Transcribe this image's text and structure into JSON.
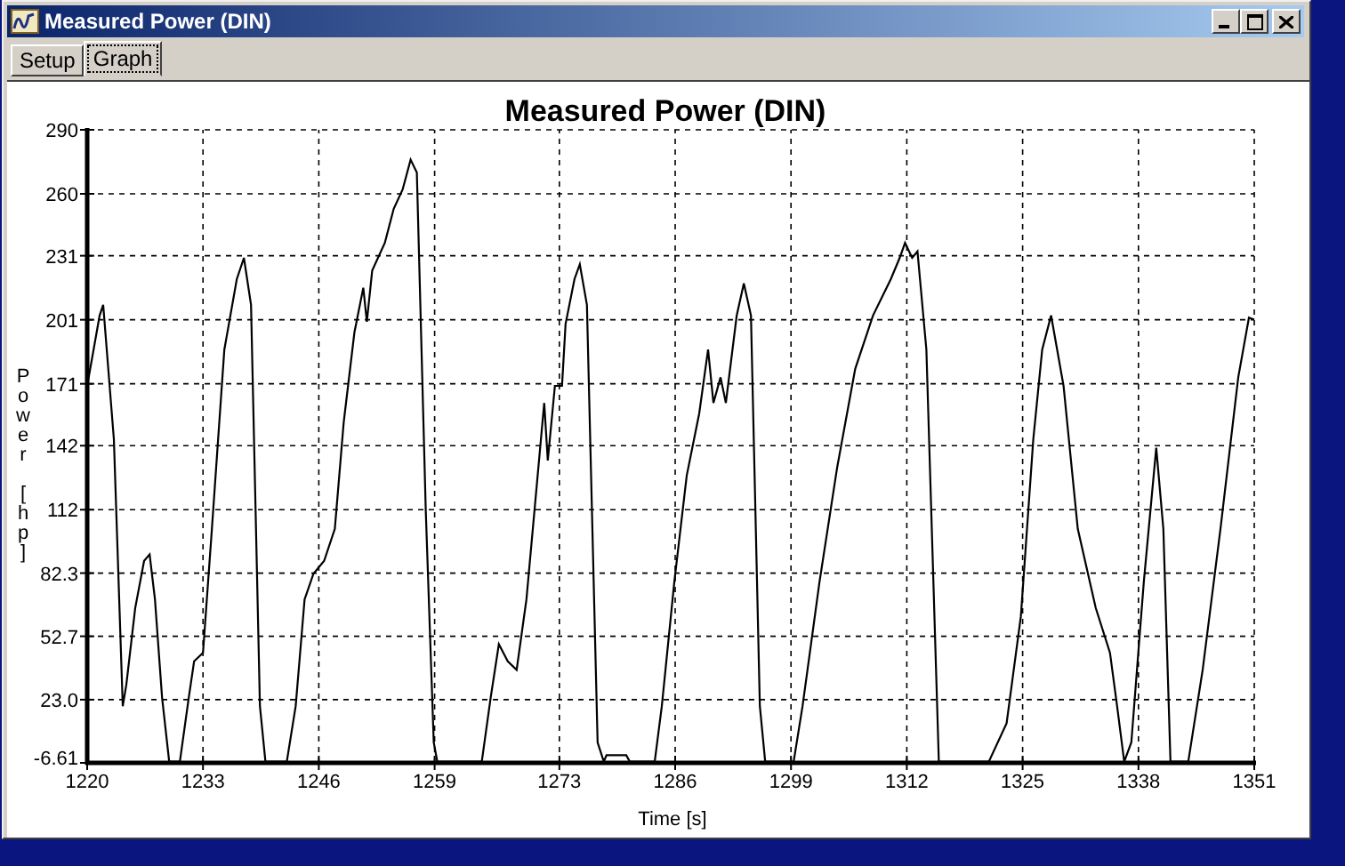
{
  "window": {
    "title": "Measured Power (DIN)"
  },
  "tabs": [
    {
      "label": "Setup",
      "selected": false
    },
    {
      "label": "Graph",
      "selected": true
    }
  ],
  "chart_data": {
    "type": "line",
    "title": "Measured Power (DIN)",
    "xlabel": "Time [s]",
    "ylabel": "Power [hp]",
    "grid": true,
    "xlim": [
      1220,
      1351
    ],
    "ylim": [
      -6.61,
      290
    ],
    "xticks": [
      1220,
      1233,
      1246,
      1259,
      1273,
      1286,
      1299,
      1312,
      1325,
      1338,
      1351
    ],
    "yticks": [
      -6.61,
      {
        "value": 23,
        "label": "23.0"
      },
      52.7,
      82.3,
      112,
      142,
      171,
      201,
      231,
      260,
      290
    ],
    "x": [
      1220,
      1221.4,
      1221.8,
      1223,
      1224,
      1224.4,
      1225.4,
      1226.4,
      1227,
      1227.6,
      1228.4,
      1229.2,
      1230.4,
      1231.4,
      1232,
      1233,
      1234,
      1235.4,
      1236.8,
      1237.6,
      1238.4,
      1239.4,
      1240,
      1242.4,
      1243.4,
      1244.4,
      1245.4,
      1246.6,
      1247.8,
      1248.8,
      1250,
      1251,
      1251.4,
      1252,
      1253.4,
      1254.4,
      1255.4,
      1256.3,
      1257,
      1258,
      1258.9,
      1259.3,
      1264.3,
      1265.3,
      1266.2,
      1267.2,
      1268.2,
      1269.3,
      1270.3,
      1271.3,
      1271.7,
      1272.5,
      1273.3,
      1273.7,
      1274.7,
      1275.3,
      1276.1,
      1277.3,
      1278,
      1278.3,
      1280.5,
      1280.9,
      1283.7,
      1284.5,
      1285.9,
      1287.3,
      1288.7,
      1289.7,
      1290.3,
      1291.1,
      1291.7,
      1292.9,
      1293.7,
      1294.5,
      1295.5,
      1296.1,
      1299.3,
      1300.3,
      1302.2,
      1304.2,
      1306.2,
      1308.2,
      1310.2,
      1311.2,
      1311.8,
      1312.6,
      1313.2,
      1314.2,
      1315.6,
      1321.2,
      1323.2,
      1324.8,
      1326.2,
      1327.2,
      1328.2,
      1329.6,
      1331.2,
      1333.2,
      1334.8,
      1335.6,
      1336.4,
      1337.2,
      1338.6,
      1340,
      1340.8,
      1341.6,
      1343.6,
      1345.2,
      1347.2,
      1349.2,
      1350.4,
      1351
    ],
    "series": [
      {
        "color": "#000000",
        "values": [
          170,
          203,
          208,
          145,
          20,
          30,
          66,
          88,
          91,
          70,
          24,
          -6,
          -6,
          24,
          41,
          45,
          103,
          187,
          220,
          230,
          208,
          20,
          -6,
          -6,
          20,
          70,
          82,
          88,
          103,
          153,
          195,
          216,
          200,
          224,
          237,
          253,
          262,
          276,
          270,
          112,
          3,
          -6,
          -6,
          24,
          49,
          41,
          37,
          70,
          116,
          162,
          135,
          170,
          170,
          199,
          220,
          227,
          208,
          3,
          -6,
          -3,
          -3,
          -6,
          -6,
          20,
          78,
          128,
          157,
          187,
          162,
          174,
          162,
          203,
          218,
          203,
          20,
          -6,
          -6,
          20,
          78,
          132,
          178,
          203,
          220,
          230,
          237,
          230,
          233,
          187,
          -6,
          -6,
          12,
          62,
          145,
          187,
          203,
          170,
          103,
          66,
          45,
          20,
          -6,
          3,
          78,
          141,
          103,
          -6,
          -6,
          37,
          103,
          174,
          202,
          201
        ]
      }
    ]
  }
}
